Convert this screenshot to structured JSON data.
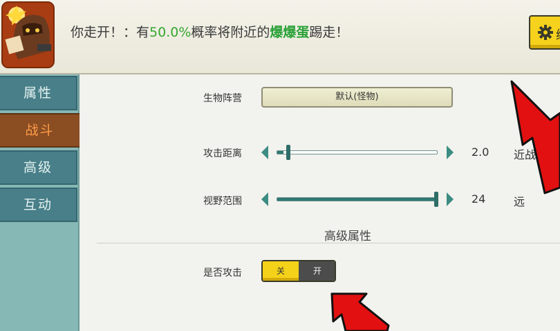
{
  "header": {
    "desc_prefix": "你走开！：有",
    "desc_percent": "50.0%",
    "desc_middle": "概率将附近的",
    "desc_target": "爆爆蛋",
    "desc_suffix": "踢走！",
    "top_button_label": "编",
    "top_button_icon": "gear-icon"
  },
  "sidebar": {
    "tabs": [
      {
        "label": "属性"
      },
      {
        "label": "战斗"
      },
      {
        "label": "高级"
      },
      {
        "label": "互动"
      }
    ],
    "active_tab": "战斗"
  },
  "settings": {
    "faction": {
      "label": "生物阵营",
      "value": "默认(怪物)"
    },
    "attack_range": {
      "label": "攻击距离",
      "value": "2.0",
      "unit": "近战",
      "level": 0.04
    },
    "view_range": {
      "label": "视野范围",
      "value": "24",
      "unit": "远",
      "level": 1.0
    },
    "advanced_title": "高级属性",
    "can_attack": {
      "label": "是否攻击",
      "off_label": "关",
      "on_label": "开",
      "selected": "关"
    }
  },
  "colors": {
    "accent_yellow": "#f5d21a",
    "tab_teal": "#487f89",
    "tab_active": "#8b4d22",
    "highlight_green": "#2aa138",
    "annotation_red": "#e21010"
  }
}
